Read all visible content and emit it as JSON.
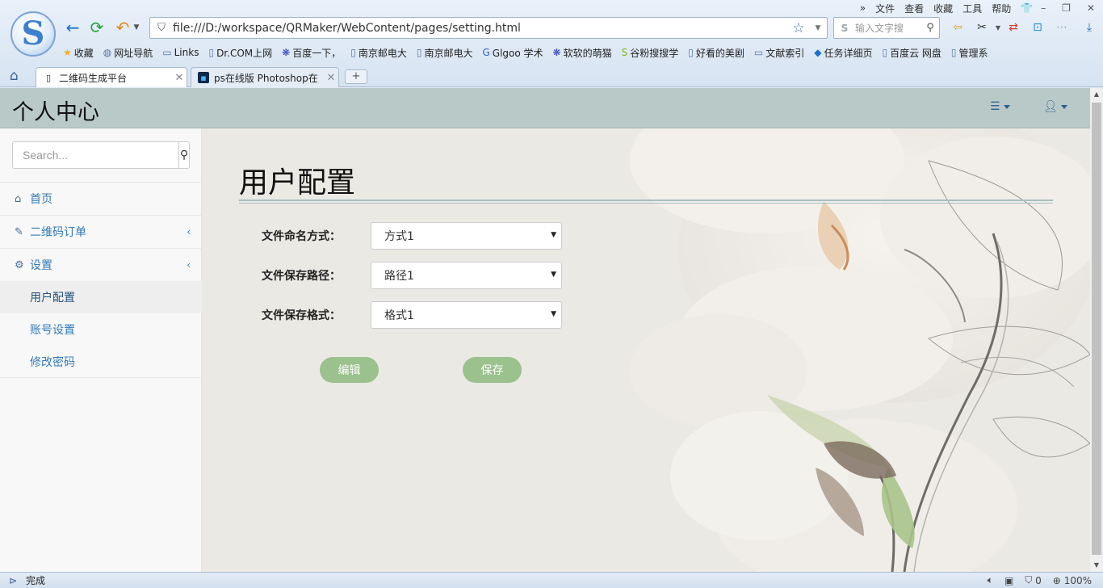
{
  "browser": {
    "menu": [
      "文件",
      "查看",
      "收藏",
      "工具",
      "帮助"
    ],
    "url": "file:///D:/workspace/QRMaker/WebContent/pages/setting.html",
    "search_placeholder": "输入文字搜",
    "bookmarks": [
      "收藏",
      "网址导航",
      "Links",
      "Dr.COM上网",
      "百度一下，",
      "南京邮电大",
      "南京邮电大",
      "Glgoo 学术",
      "软软的萌猫",
      "谷粉搜搜学",
      "好看的美剧",
      "文献索引",
      "任务详细页",
      "百度云 网盘",
      "管理系"
    ],
    "tabs": [
      {
        "title": "二维码生成平台"
      },
      {
        "title": "ps在线版 Photoshop在"
      }
    ],
    "new_tab": "+",
    "status": {
      "text": "完成",
      "blocked_count": "0",
      "zoom": "100%"
    }
  },
  "app": {
    "brand": "个人中心",
    "sidebar": {
      "search_placeholder": "Search...",
      "items": [
        {
          "label": "首页"
        },
        {
          "label": "二维码订单"
        },
        {
          "label": "设置"
        }
      ],
      "subitems": [
        {
          "label": "用户配置"
        },
        {
          "label": "账号设置"
        },
        {
          "label": "修改密码"
        }
      ]
    },
    "page_title": "用户配置",
    "form": {
      "fields": [
        {
          "label": "文件命名方式：",
          "value": "方式1"
        },
        {
          "label": "文件保存路径：",
          "value": "路径1"
        },
        {
          "label": "文件保存格式：",
          "value": "格式1"
        }
      ],
      "edit_label": "编辑",
      "save_label": "保存"
    }
  },
  "colors": {
    "topbar": "#b9c9c8",
    "link": "#337ab7",
    "pill_button": "#9bc18d",
    "page_bg": "#eae8e3"
  }
}
